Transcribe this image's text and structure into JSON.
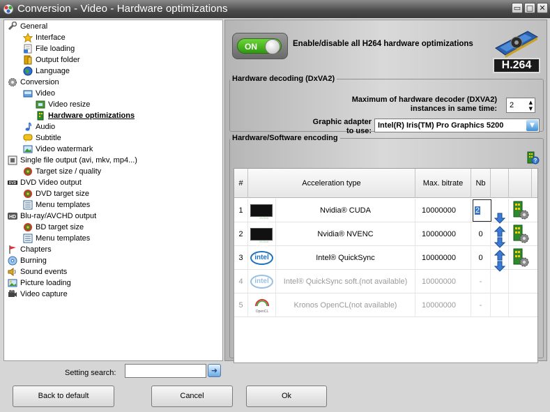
{
  "window": {
    "title": "Conversion - Video - Hardware optimizations",
    "controls": {
      "minimize": "▭",
      "maximize": "□",
      "close": "✕"
    }
  },
  "tree": {
    "items": [
      {
        "label": "General",
        "icon": "wrench-icon",
        "indent": 0
      },
      {
        "label": "Interface",
        "icon": "star-icon",
        "indent": 1
      },
      {
        "label": "File loading",
        "icon": "file-icon",
        "indent": 1
      },
      {
        "label": "Output folder",
        "icon": "folder-icon",
        "indent": 1
      },
      {
        "label": "Language",
        "icon": "globe-icon",
        "indent": 1
      },
      {
        "label": "Conversion",
        "icon": "gear-icon",
        "indent": 0
      },
      {
        "label": "Video",
        "icon": "video-icon",
        "indent": 1
      },
      {
        "label": "Video resize",
        "icon": "resize-icon",
        "indent": 2
      },
      {
        "label": "Hardware optimizations",
        "icon": "gpu-icon",
        "indent": 2,
        "selected": true
      },
      {
        "label": "Audio",
        "icon": "music-note-icon",
        "indent": 1
      },
      {
        "label": "Subtitle",
        "icon": "speech-bubble-icon",
        "indent": 1
      },
      {
        "label": "Video watermark",
        "icon": "image-icon",
        "indent": 1
      },
      {
        "label": "Single file output (avi, mkv, mp4...)",
        "icon": "film-icon",
        "indent": 0
      },
      {
        "label": "Target size / quality",
        "icon": "target-icon",
        "indent": 1
      },
      {
        "label": "DVD Video output",
        "icon": "dvd-icon",
        "indent": 0
      },
      {
        "label": "DVD target size",
        "icon": "target-icon",
        "indent": 1
      },
      {
        "label": "Menu templates",
        "icon": "menu-template-icon",
        "indent": 1
      },
      {
        "label": "Blu-ray/AVCHD output",
        "icon": "hd-icon",
        "indent": 0
      },
      {
        "label": "BD target size",
        "icon": "target-icon",
        "indent": 1
      },
      {
        "label": "Menu templates",
        "icon": "menu-template-icon",
        "indent": 1
      },
      {
        "label": "Chapters",
        "icon": "flag-icon",
        "indent": 0
      },
      {
        "label": "Burning",
        "icon": "disc-icon",
        "indent": 0
      },
      {
        "label": "Sound events",
        "icon": "speaker-icon",
        "indent": 0
      },
      {
        "label": "Picture loading",
        "icon": "picture-icon",
        "indent": 0
      },
      {
        "label": "Video capture",
        "icon": "camera-icon",
        "indent": 0
      }
    ]
  },
  "toggle": {
    "state": "ON",
    "on": true
  },
  "enable_label": "Enable/disable all H264 hardware optimizations",
  "badge": "H.264",
  "decoding": {
    "legend": "Hardware decoding (DxVA2)",
    "max_label_line1": "Maximum of hardware decoder (DXVA2)",
    "max_label_line2": "instances in same time:",
    "max_value": "2",
    "adapter_label_line1": "Graphic adapter",
    "adapter_label_line2": "to use:",
    "adapter_value": "Intel(R) Iris(TM) Pro Graphics 5200"
  },
  "encoding": {
    "legend": "Hardware/Software encoding",
    "columns": [
      "#",
      "Acceleration type",
      "Max. bitrate",
      "Nb",
      "",
      ""
    ],
    "rows": [
      {
        "num": "1",
        "logo": "nvidia-cuda",
        "name": "Nvidia® CUDA",
        "bitrate": "10000000",
        "nb": "2",
        "arrows": [
          "down"
        ],
        "enabled": true,
        "editing": true
      },
      {
        "num": "2",
        "logo": "nvidia-cuda",
        "name": "Nvidia® NVENC",
        "bitrate": "10000000",
        "nb": "0",
        "arrows": [
          "up",
          "down"
        ],
        "enabled": true
      },
      {
        "num": "3",
        "logo": "intel",
        "name": "Intel® QuickSync",
        "bitrate": "10000000",
        "nb": "0",
        "arrows": [
          "up",
          "down"
        ],
        "enabled": true
      },
      {
        "num": "4",
        "logo": "intel",
        "name": "Intel® QuickSync soft.(not available)",
        "bitrate": "10000000",
        "nb": "-",
        "arrows": [],
        "enabled": false
      },
      {
        "num": "5",
        "logo": "opencl",
        "name": "Kronos OpenCL(not available)",
        "bitrate": "10000000",
        "nb": "-",
        "arrows": [],
        "enabled": false
      }
    ]
  },
  "search": {
    "label": "Setting search:",
    "value": "",
    "go": "➜"
  },
  "buttons": {
    "back": "Back to default",
    "cancel": "Cancel",
    "ok": "Ok"
  }
}
